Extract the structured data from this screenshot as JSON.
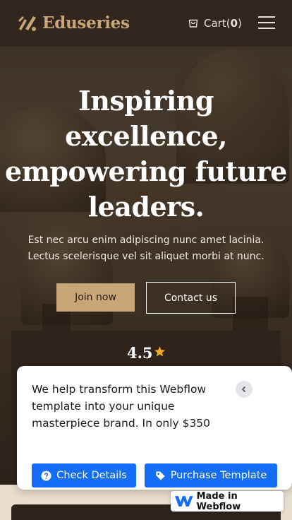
{
  "header": {
    "brand": "Eduseries",
    "cart_label": "Cart(",
    "cart_count": "0",
    "cart_close": ")"
  },
  "hero": {
    "title": "Inspiring excellence, empowering future leaders.",
    "subtitle": "Est nec arcu enim adipiscing nunc amet lacinia. Lectus scelerisque vel sit aliquet morbi at nunc.",
    "join_label": "Join now",
    "contact_label": "Contact us"
  },
  "rating": {
    "value": "4.5"
  },
  "promo": {
    "text": "We help transform this Webflow template into your unique masterpiece brand. In only $350",
    "check_label": "Check Details",
    "purchase_label": "Purchase Template"
  },
  "badge": {
    "label": "Made in Webflow"
  },
  "colors": {
    "brand_gold": "#c8a678",
    "dark_brown": "#2e241c",
    "webflow_blue": "#146ef5",
    "star": "#f5a623"
  },
  "icons": {
    "logo": "brand-mark-icon",
    "cart": "cart-icon",
    "menu": "hamburger-menu-icon",
    "star": "star-icon",
    "close": "chevron-left-icon",
    "help": "question-circle-icon",
    "tag": "price-tag-icon",
    "webflow": "webflow-logo-icon"
  }
}
